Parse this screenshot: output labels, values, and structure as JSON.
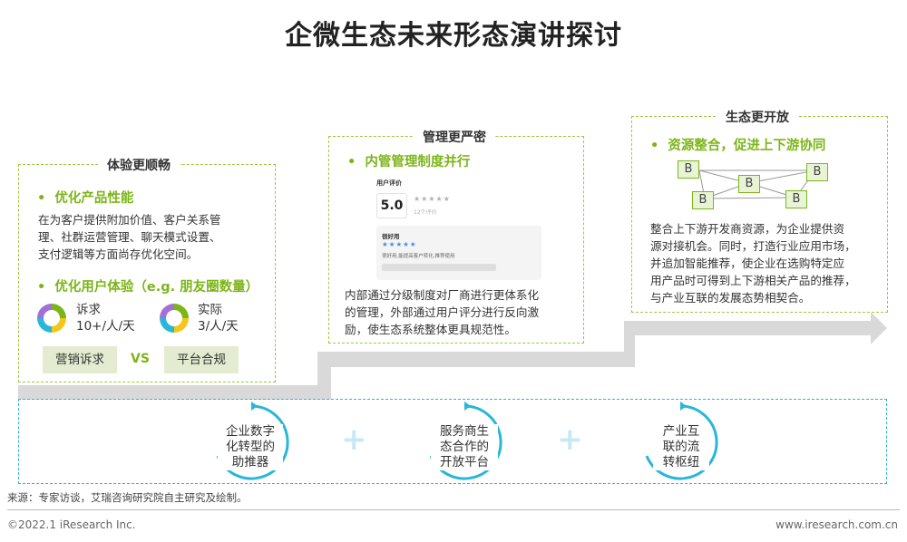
{
  "title": "企微生态未来形态演讲探讨",
  "panels": {
    "left": {
      "label": "体验更顺畅",
      "head1": "优化产品性能",
      "text1": [
        "在为客户提供附加价值、客户关系管",
        "理、社群运营管理、聊天模式设置、",
        "支付逻辑等方面尚存优化空间。"
      ],
      "head2": "优化用户体验（e.g. 朋友圈数量）",
      "metrics": [
        {
          "label": "诉求",
          "value": "10+/人/天"
        },
        {
          "label": "实际",
          "value": "3/人/天"
        }
      ],
      "tags": [
        "营销诉求",
        "平台合规"
      ],
      "vs": "VS"
    },
    "middle": {
      "label": "管理更严密",
      "head1": "内管管理制度并行",
      "mock": {
        "title": "用户评价",
        "score": "5.0",
        "stars": "★★★★★",
        "count": "12个评价",
        "review_title": "很好用",
        "review_stars": "★★★★★",
        "review_text": "很好用,能提高客户转化,推荐使用"
      },
      "text": [
        "内部通过分级制度对厂商进行更体系化",
        "的管理，外部通过用户评分进行反向激",
        "励，使生态系统整体更具规范性。"
      ]
    },
    "right": {
      "label": "生态更开放",
      "head1": "资源整合，促进上下游协同",
      "node_letter": "B",
      "text": [
        "整合上下游开发商资源，为企业提供资",
        "源对接机会。同时，打造行业应用市场，",
        "并追加智能推荐，使企业在选购特定应",
        "用产品时可得到上下游相关产品的推荐，",
        "与产业互联的发展态势相契合。"
      ]
    }
  },
  "circles": [
    {
      "lines": [
        "企业数字",
        "化转型的",
        "助推器"
      ]
    },
    {
      "lines": [
        "服务商生",
        "态合作的",
        "开放平台"
      ]
    },
    {
      "lines": [
        "产业互",
        "联的流",
        "转枢纽"
      ]
    }
  ],
  "plus": "+",
  "source": "来源：专家访谈，艾瑞咨询研究院自主研究及绘制。",
  "copyright": "©2022.1 iResearch Inc.",
  "website": "www.iresearch.com.cn",
  "colors": {
    "green": "#7cb518",
    "panel_border": "#9cc93d",
    "cyan": "#29b6d9",
    "arrow_gray": "#d9d9d9"
  }
}
